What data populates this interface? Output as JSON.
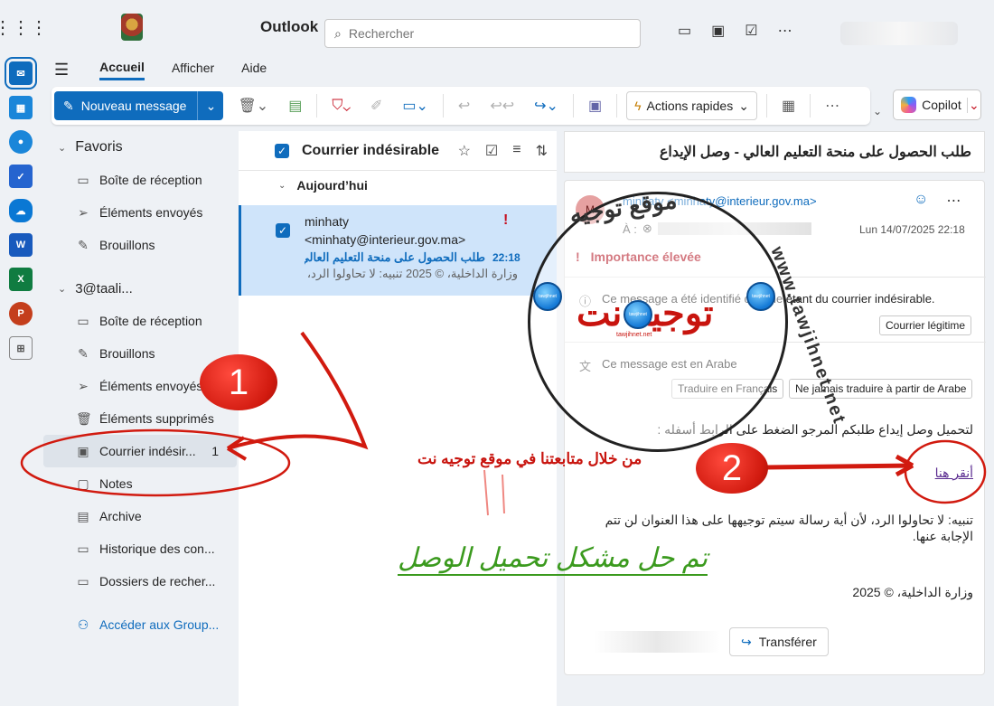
{
  "app": {
    "name": "Outlook"
  },
  "search": {
    "placeholder": "Rechercher"
  },
  "ribbon": {
    "tabs": [
      "Accueil",
      "Afficher",
      "Aide"
    ],
    "new_message": "Nouveau message",
    "quick_actions": "Actions rapides",
    "copilot": "Copilot"
  },
  "folders": {
    "favorites_label": "Favoris",
    "favorites": [
      {
        "label": "Boîte de réception",
        "icon": "inbox-icon"
      },
      {
        "label": "Éléments envoyés",
        "icon": "send-icon"
      },
      {
        "label": "Brouillons",
        "icon": "pencil-icon"
      }
    ],
    "account_label": "3@taali...",
    "account_folders": [
      {
        "label": "Boîte de réception",
        "icon": "inbox-icon"
      },
      {
        "label": "Brouillons",
        "icon": "pencil-icon"
      },
      {
        "label": "Éléments envoyés",
        "icon": "send-icon"
      },
      {
        "label": "Éléments supprimés",
        "icon": "trash-icon"
      },
      {
        "label": "Courrier indésir...",
        "icon": "junk-folder-icon",
        "count": "1",
        "selected": true
      },
      {
        "label": "Notes",
        "icon": "note-icon"
      },
      {
        "label": "Archive",
        "icon": "archive-icon"
      },
      {
        "label": "Historique des con...",
        "icon": "folder-icon"
      },
      {
        "label": "Dossiers de recher...",
        "icon": "search-folder-icon"
      }
    ],
    "groups_link": "Accéder aux Group..."
  },
  "message_list": {
    "title": "Courrier indésirable",
    "group": "Aujourd’hui",
    "message": {
      "from_name": "minhaty",
      "from_email": "<minhaty@interieur.gov.ma>",
      "subject": "طلب الحصول على منحة التعليم العالي - وصل الإيداع",
      "time": "22:18",
      "preview": "وزارة الداخلية، © 2025 تنبيه: لا تحاولوا الرد، لأن أية رسالة سيتم توجيهها على هذا العنوان لن تتم الإجابة عنها."
    }
  },
  "reading": {
    "subject": "طلب الحصول على منحة التعليم العالي - وصل الإيداع",
    "avatar_initial": "M",
    "sender": "minhaty <minhaty@interieur.gov.ma>",
    "to_label": "À :",
    "date": "Lun 14/07/2025 22:18",
    "importance": "Importance élevée",
    "junk_notice": "Ce message a été identifié comme étant du courrier indésirable.",
    "junk_button": "Courrier légitime",
    "lang_notice": "Ce message est en Arabe",
    "translate_button": "Traduire en Français",
    "never_translate_button": "Ne jamais traduire à partir de Arabe",
    "body_line1": "لتحميل وصل إيداع طلبكم المرجو الضغط على الرابط أسفله :",
    "body_link": "أنقر هنا",
    "body_warning": "تنبيه: لا تحاولوا الرد، لأن أية رسالة سيتم توجيهها على هذا العنوان لن تتم الإجابة عنها.",
    "body_footer": "وزارة الداخلية، © 2025",
    "forward_button": "Transférer"
  },
  "annotations": {
    "badge1": "1",
    "badge2": "2",
    "note_red": "من خلال متابعتنا في موقع توجيه نت",
    "note_green": "تم حل مشكل تحميل الوصل",
    "watermark_title": "توجيه نت",
    "watermark_ring_top": "موقع توجيه",
    "watermark_ring_side": "www.tawjihnet.net",
    "watermark_sub": "tawjihnet.net",
    "globe_label": "tawjihnet"
  },
  "colors": {
    "accent": "#0f6cbd",
    "annotation_red": "#c8140e",
    "annotation_green": "#3b9a1e",
    "importance_red": "#b10e1c"
  }
}
